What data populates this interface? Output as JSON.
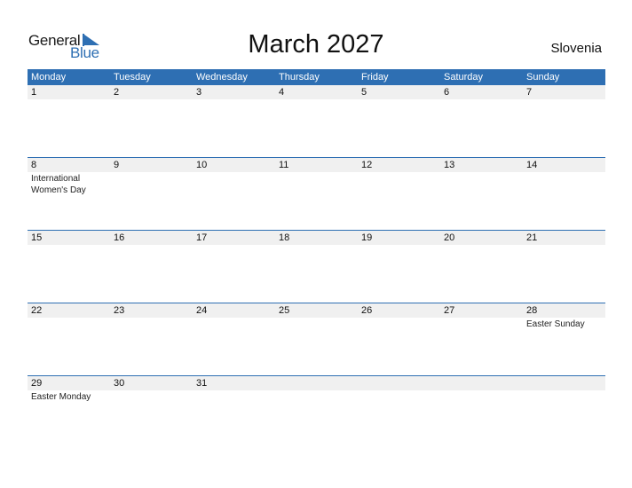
{
  "logo": {
    "general": "General",
    "blue": "Blue"
  },
  "title": "March 2027",
  "country": "Slovenia",
  "colors": {
    "accent": "#2e6fb3",
    "daybar": "#f0f0f0"
  },
  "weekdays": [
    "Monday",
    "Tuesday",
    "Wednesday",
    "Thursday",
    "Friday",
    "Saturday",
    "Sunday"
  ],
  "weeks": [
    {
      "days": [
        "1",
        "2",
        "3",
        "4",
        "5",
        "6",
        "7"
      ],
      "events": [
        "",
        "",
        "",
        "",
        "",
        "",
        ""
      ]
    },
    {
      "days": [
        "8",
        "9",
        "10",
        "11",
        "12",
        "13",
        "14"
      ],
      "events": [
        "International Women's Day",
        "",
        "",
        "",
        "",
        "",
        ""
      ]
    },
    {
      "days": [
        "15",
        "16",
        "17",
        "18",
        "19",
        "20",
        "21"
      ],
      "events": [
        "",
        "",
        "",
        "",
        "",
        "",
        ""
      ]
    },
    {
      "days": [
        "22",
        "23",
        "24",
        "25",
        "26",
        "27",
        "28"
      ],
      "events": [
        "",
        "",
        "",
        "",
        "",
        "",
        "Easter Sunday"
      ]
    },
    {
      "days": [
        "29",
        "30",
        "31",
        "",
        "",
        "",
        ""
      ],
      "events": [
        "Easter Monday",
        "",
        "",
        "",
        "",
        "",
        ""
      ]
    }
  ]
}
